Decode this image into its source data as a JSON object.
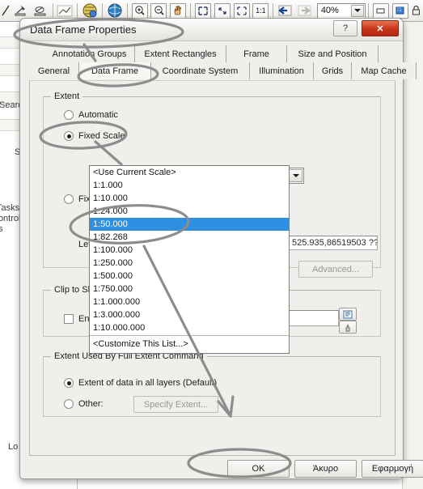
{
  "app": {
    "toolbar": {
      "zoom_value": "40%",
      "icons": [
        "measure-icon",
        "identify-icon",
        "chart-icon",
        "layers-globe-icon",
        "globe-icon",
        "zoom-in-icon",
        "zoom-out-icon",
        "pan-hand-icon",
        "full-extent-icon",
        "fixed-zoom-in-icon",
        "fixed-zoom-out-icon",
        "one-to-one-icon",
        "go-back-extent-icon",
        "go-forward-extent-icon",
        "minimize-window-icon",
        "select-features-icon",
        "lock-icon"
      ]
    },
    "background_panel": {
      "search_label": "Search",
      "se_label": "Se",
      "tasks_label": "Tasks",
      "control_label": "Control",
      "s_label": "s",
      "lo_label": "Lo"
    }
  },
  "dialog": {
    "title": "Data Frame Properties",
    "help_button": "?",
    "close_button": "✕",
    "tabs_row1": [
      {
        "label": "Annotation Groups",
        "selected": false
      },
      {
        "label": "Extent Rectangles",
        "selected": false
      },
      {
        "label": "Frame",
        "selected": false
      },
      {
        "label": "Size and Position",
        "selected": false
      }
    ],
    "tabs_row2": [
      {
        "label": "General",
        "selected": false
      },
      {
        "label": "Data Frame",
        "selected": true
      },
      {
        "label": "Coordinate System",
        "selected": false
      },
      {
        "label": "Illumination",
        "selected": false
      },
      {
        "label": "Grids",
        "selected": false
      },
      {
        "label": "Map Cache",
        "selected": false
      }
    ],
    "extent_group": {
      "label": "Extent",
      "automatic": {
        "label": "Automatic",
        "selected": false
      },
      "fixed_scale": {
        "label": "Fixed Scale",
        "selected": true
      },
      "fixed_extent": {
        "label": "Fixed Extent",
        "selected": false
      },
      "left_label": "Left:",
      "right_value": "525.935,86519503 ??",
      "advanced_button": "Advanced..."
    },
    "scale_combo": {
      "value": "<Use Current Scale>",
      "dropdown_arrow": "chevron-down-icon",
      "options": [
        {
          "label": "<Use Current Scale>",
          "highlighted": false
        },
        {
          "label": "1:1.000",
          "highlighted": false
        },
        {
          "label": "1:10.000",
          "highlighted": false
        },
        {
          "label": "1:24.000",
          "highlighted": false
        },
        {
          "label": "1:50.000",
          "highlighted": true
        },
        {
          "label": "1:82.268",
          "highlighted": false
        },
        {
          "label": "1:100.000",
          "highlighted": false
        },
        {
          "label": "1:250.000",
          "highlighted": false
        },
        {
          "label": "1:500.000",
          "highlighted": false
        },
        {
          "label": "1:750.000",
          "highlighted": false
        },
        {
          "label": "1:1.000.000",
          "highlighted": false
        },
        {
          "label": "1:3.000.000",
          "highlighted": false
        },
        {
          "label": "1:10.000.000",
          "highlighted": false
        }
      ],
      "customize": "<Customize This List...>"
    },
    "clip_group": {
      "label": "Clip to Shape",
      "enable": {
        "label": "Enable",
        "checked": false
      },
      "specify_shape_icon": "specify-shape-icon",
      "options_icon": "shape-options-icon"
    },
    "extent_used_group": {
      "label": "Extent Used By Full Extent Command",
      "default_option": {
        "label": "Extent of data in all layers (Default)",
        "selected": true
      },
      "other_option": {
        "label": "Other:",
        "selected": false
      },
      "specify_extent_button": "Specify Extent..."
    },
    "footer": {
      "ok": "OK",
      "cancel": "Άκυρο",
      "apply": "Εφαρμογή"
    }
  },
  "colors": {
    "highlight": "#2f8fe0",
    "dialog_bg": "#f0efeb",
    "close_red": "#c9341a",
    "ink": "#8a8a8a"
  }
}
